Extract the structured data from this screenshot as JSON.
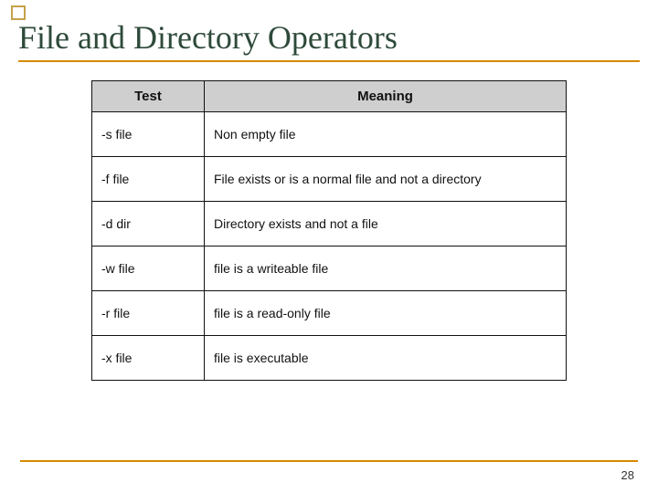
{
  "title": "File and Directory Operators",
  "table": {
    "headers": {
      "test": "Test",
      "meaning": "Meaning"
    },
    "rows": [
      {
        "test": "-s file",
        "meaning": "Non empty file"
      },
      {
        "test": "-f file",
        "meaning": "File exists or is a normal file and not a directory"
      },
      {
        "test": "-d dir",
        "meaning": "Directory exists and not a file"
      },
      {
        "test": "-w file",
        "meaning": "file is a writeable file"
      },
      {
        "test": "-r file",
        "meaning": "file is a read-only file"
      },
      {
        "test": "-x file",
        "meaning": "file is executable"
      }
    ]
  },
  "page_number": "28"
}
